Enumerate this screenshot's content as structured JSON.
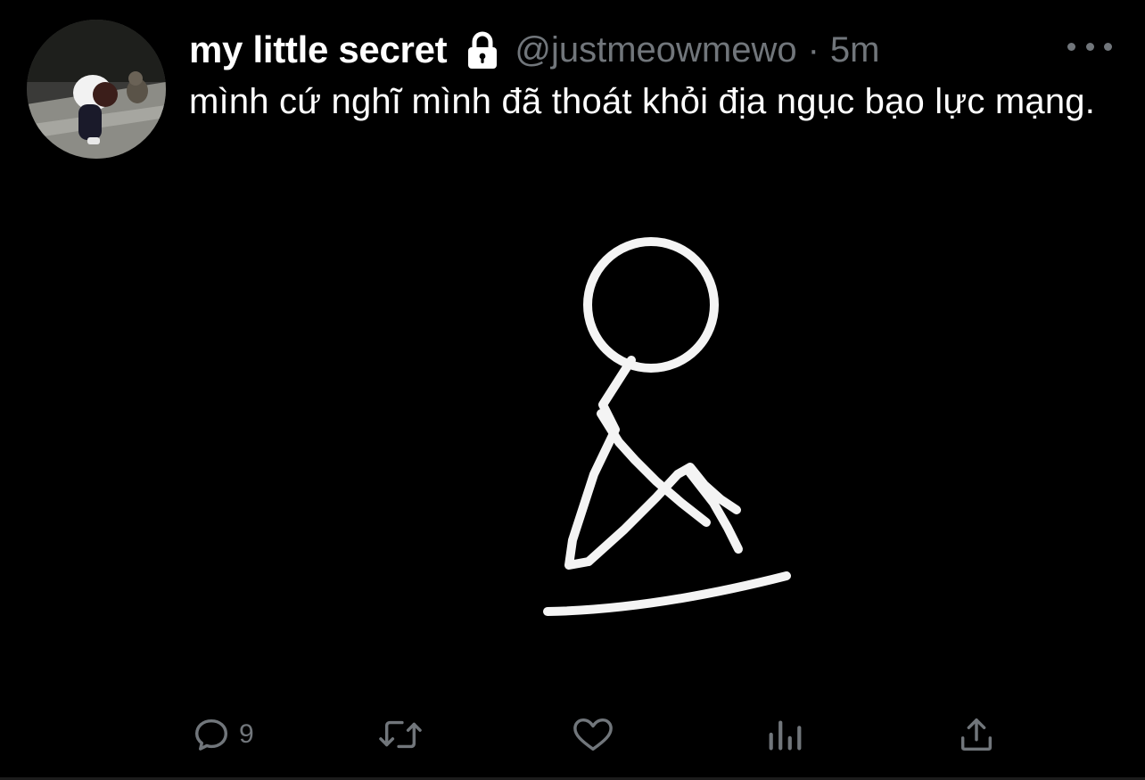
{
  "tweet": {
    "display_name": "my little secret",
    "handle": "@justmeowmewo",
    "separator": "·",
    "time": "5m",
    "text": "mình cứ nghĩ mình đã thoát khỏi địa ngục bạo lực mạng.",
    "protected_icon": "lock-icon",
    "media_description": "stick-figure-drawing"
  },
  "actions": {
    "reply": {
      "icon": "reply-icon",
      "count": "9"
    },
    "retweet": {
      "icon": "retweet-icon"
    },
    "like": {
      "icon": "heart-icon"
    },
    "analytics": {
      "icon": "analytics-icon"
    },
    "share": {
      "icon": "share-icon"
    }
  },
  "colors": {
    "background": "#000000",
    "text": "#ffffff",
    "secondary": "#71767b"
  }
}
